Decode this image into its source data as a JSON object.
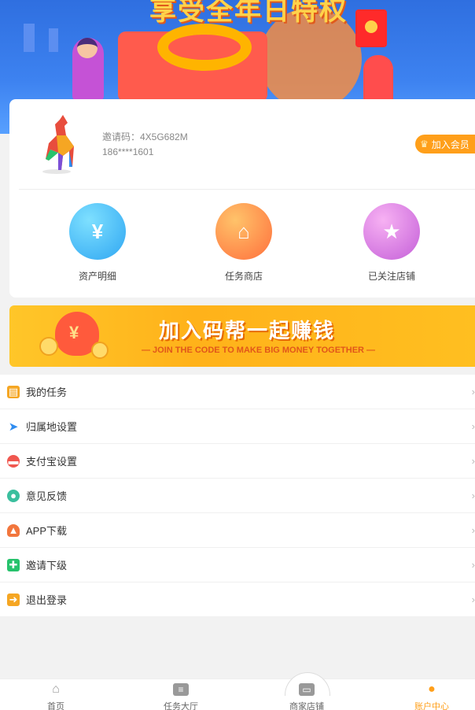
{
  "banner": {
    "title": "享受全年日特权"
  },
  "profile": {
    "invite_code": "邀请码：4X5G682M",
    "phone": "186****1601",
    "vip_button": "加入会员"
  },
  "quick_actions": [
    {
      "label": "资产明细",
      "icon": "money-bag-icon"
    },
    {
      "label": "任务商店",
      "icon": "store-icon"
    },
    {
      "label": "已关注店铺",
      "icon": "star-icon"
    }
  ],
  "promo": {
    "main_text": "加入码帮一起赚钱",
    "sub_text": "— JOIN THE CODE TO MAKE BIG MONEY TOGETHER —"
  },
  "menu": [
    {
      "label": "我的任务",
      "icon": "task-list-icon",
      "color": "#f5a623"
    },
    {
      "label": "归属地设置",
      "icon": "location-arrow-icon",
      "color": "#2f8cf0"
    },
    {
      "label": "支付宝设置",
      "icon": "alipay-icon",
      "color": "#f0574f"
    },
    {
      "label": "意见反馈",
      "icon": "feedback-icon",
      "color": "#3bbf9e"
    },
    {
      "label": "APP下载",
      "icon": "download-icon",
      "color": "#f2763d"
    },
    {
      "label": "邀请下级",
      "icon": "invite-icon",
      "color": "#27c26c"
    },
    {
      "label": "退出登录",
      "icon": "logout-icon",
      "color": "#f5a623"
    }
  ],
  "tabs": [
    {
      "label": "首页",
      "icon": "home-icon"
    },
    {
      "label": "任务大厅",
      "icon": "task-hall-icon"
    },
    {
      "label": "商家店铺",
      "icon": "shop-icon"
    },
    {
      "label": "账户中心",
      "icon": "account-icon"
    }
  ],
  "colors": {
    "accent": "#ff9f1a",
    "banner_blue": "#3d82f0"
  }
}
